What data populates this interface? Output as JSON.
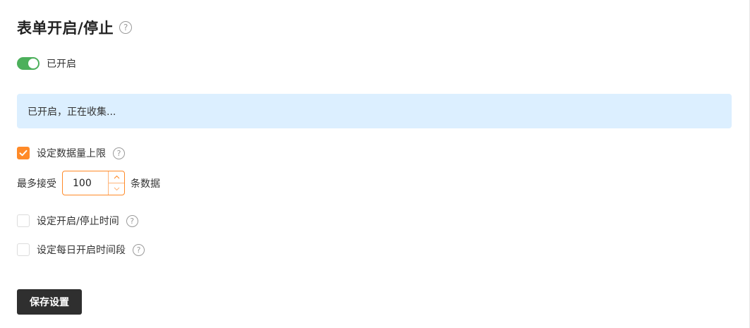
{
  "header": {
    "title": "表单开启/停止",
    "help_icon": "question-circle-icon"
  },
  "status_toggle": {
    "on": true,
    "label": "已开启",
    "color": "#4cb05b"
  },
  "banner": {
    "text": "已开启，正在收集...",
    "background": "#dcefff"
  },
  "options": {
    "data_limit": {
      "checked": true,
      "label": "设定数据量上限",
      "prefix": "最多接受",
      "value": "100",
      "suffix": "条数据"
    },
    "start_stop_time": {
      "checked": false,
      "label": "设定开启/停止时间"
    },
    "daily_period": {
      "checked": false,
      "label": "设定每日开启时间段"
    }
  },
  "actions": {
    "save_label": "保存设置"
  },
  "accent_color": "#ff8a28"
}
